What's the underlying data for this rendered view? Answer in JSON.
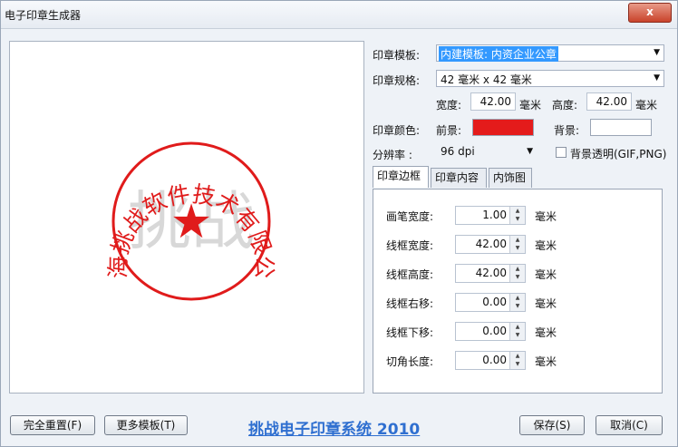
{
  "window": {
    "title": "电子印章生成器",
    "close_label": "x"
  },
  "stamp": {
    "text": "上海挑战软件技术有限公司",
    "star": "★",
    "watermark": "挑战",
    "color": "#e01b1b"
  },
  "form": {
    "template_label": "印章模板:",
    "template_value": "内建模板: 内资企业公章",
    "spec_label": "印章规格:",
    "spec_value": "42 毫米  x  42 毫米",
    "width_label": "宽度:",
    "width_value": "42.00",
    "width_unit": "毫米",
    "height_label": "高度:",
    "height_value": "42.00",
    "height_unit": "毫米",
    "color_label": "印章颜色:",
    "fg_label": "前景:",
    "fg_color": "#e41b1b",
    "bg_label": "背景:",
    "bg_color": "#ffffff",
    "dpi_label": "分辨率 :",
    "dpi_value": "96 dpi",
    "transparent_label": "背景透明(GIF,PNG)"
  },
  "tabs": [
    "印章边框",
    "印章内容",
    "内饰图"
  ],
  "border_fields": [
    {
      "label": "画笔宽度:",
      "value": "1.00",
      "unit": "毫米"
    },
    {
      "label": "线框宽度:",
      "value": "42.00",
      "unit": "毫米"
    },
    {
      "label": "线框高度:",
      "value": "42.00",
      "unit": "毫米"
    },
    {
      "label": "线框右移:",
      "value": "0.00",
      "unit": "毫米"
    },
    {
      "label": "线框下移:",
      "value": "0.00",
      "unit": "毫米"
    },
    {
      "label": "切角长度:",
      "value": "0.00",
      "unit": "毫米"
    }
  ],
  "footer": {
    "reset_label": "完全重置(F)",
    "more_label": "更多模板(T)",
    "brand": "挑战电子印章系统 2010",
    "save_label": "保存(S)",
    "cancel_label": "取消(C)"
  }
}
